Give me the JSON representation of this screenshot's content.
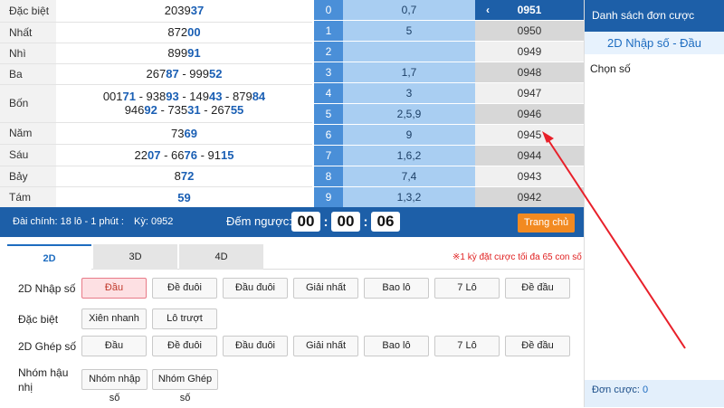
{
  "results": [
    {
      "label": "Đặc biệt",
      "lines": [
        [
          [
            "2039",
            ""
          ],
          [
            "37",
            "hl"
          ]
        ]
      ]
    },
    {
      "label": "Nhất",
      "lines": [
        [
          [
            "872",
            ""
          ],
          [
            "00",
            "hl"
          ]
        ]
      ]
    },
    {
      "label": "Nhì",
      "lines": [
        [
          [
            "899",
            ""
          ],
          [
            "91",
            "hl"
          ]
        ]
      ]
    },
    {
      "label": "Ba",
      "lines": [
        [
          [
            "267",
            ""
          ],
          [
            "87",
            "hl"
          ],
          [
            " - 999",
            ""
          ],
          [
            "52",
            "hl"
          ]
        ]
      ]
    },
    {
      "label": "Bốn",
      "lines": [
        [
          [
            "001",
            ""
          ],
          [
            "71",
            "hl"
          ],
          [
            " - 938",
            ""
          ],
          [
            "93",
            "hl"
          ],
          [
            " - 149",
            ""
          ],
          [
            "43",
            "hl"
          ],
          [
            " - 879",
            ""
          ],
          [
            "84",
            "hl"
          ]
        ],
        [
          [
            "946",
            ""
          ],
          [
            "92",
            "hl"
          ],
          [
            " - 735",
            ""
          ],
          [
            "31",
            "hl"
          ],
          [
            " - 267",
            ""
          ],
          [
            "55",
            "hl"
          ]
        ]
      ]
    },
    {
      "label": "Năm",
      "lines": [
        [
          [
            "73",
            ""
          ],
          [
            "69",
            "hl"
          ]
        ]
      ]
    },
    {
      "label": "Sáu",
      "lines": [
        [
          [
            "22",
            ""
          ],
          [
            "07",
            "hl"
          ],
          [
            " - 66",
            ""
          ],
          [
            "76",
            "hl"
          ],
          [
            " - 91",
            ""
          ],
          [
            "15",
            "hl"
          ]
        ]
      ]
    },
    {
      "label": "Bảy",
      "lines": [
        [
          [
            "8",
            ""
          ],
          [
            "72",
            "hl"
          ]
        ]
      ]
    },
    {
      "label": "Tám",
      "lines": [
        [
          [
            "",
            ""
          ],
          [
            "59",
            "hl"
          ]
        ]
      ]
    }
  ],
  "heads": [
    {
      "n": "0",
      "v": "0,7"
    },
    {
      "n": "1",
      "v": "5"
    },
    {
      "n": "2",
      "v": ""
    },
    {
      "n": "3",
      "v": "1,7"
    },
    {
      "n": "4",
      "v": "3"
    },
    {
      "n": "5",
      "v": "2,5,9"
    },
    {
      "n": "6",
      "v": "9"
    },
    {
      "n": "7",
      "v": "1,6,2"
    },
    {
      "n": "8",
      "v": "7,4"
    },
    {
      "n": "9",
      "v": "1,3,2"
    }
  ],
  "periods": {
    "current": "0951",
    "chev": "‹",
    "list": [
      "0950",
      "0949",
      "0948",
      "0947",
      "0946",
      "0945",
      "0944",
      "0943",
      "0942"
    ]
  },
  "sidebar": {
    "title": "Danh sách đơn cược",
    "subtitle": "2D Nhập số - Đầu",
    "pick": "Chọn số",
    "footer": "Đơn cược: ",
    "footer_count": "0"
  },
  "bar": {
    "info": "Đài chính: 18 lô - 1 phút :",
    "ky": "Kỳ: 0952",
    "countdown_label": "Đếm ngược:",
    "h": "00",
    "m": "00",
    "s": "06",
    "home": "Trang chủ"
  },
  "tabs": [
    "2D",
    "3D",
    "4D"
  ],
  "note": "※1 kỳ đặt cược tối đa 65 con số",
  "rows": [
    {
      "label": "2D Nhập số",
      "buttons": [
        "Đầu",
        "Đề đuôi",
        "Đầu đuôi",
        "Giải nhất",
        "Bao lô",
        "7 Lô",
        "Đề đầu"
      ]
    },
    {
      "label": "Đặc biệt",
      "buttons": [
        "Xiên nhanh",
        "Lô trượt"
      ]
    },
    {
      "label": "2D Ghép số",
      "buttons": [
        "Đầu",
        "Đề đuôi",
        "Đầu đuôi",
        "Giải nhất",
        "Bao lô",
        "7 Lô",
        "Đề đầu"
      ]
    },
    {
      "label": "Nhóm hậu nhị",
      "buttons": [
        "Nhóm nhập số",
        "Nhóm Ghép số"
      ]
    }
  ],
  "accent": "#1d5fa8",
  "arrow_color": "#e8202a"
}
